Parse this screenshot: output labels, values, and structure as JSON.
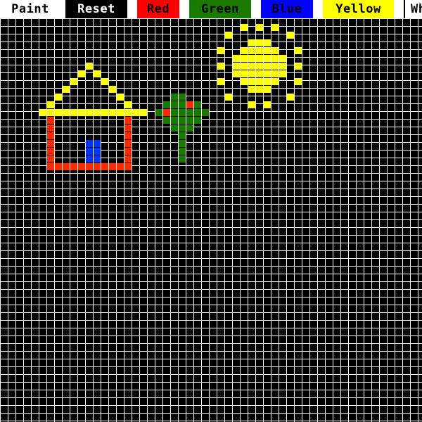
{
  "toolbar": {
    "title": "Paint",
    "reset_label": "Reset",
    "colors": [
      {
        "label": "Red",
        "bg": "#ff0000",
        "fg": "#000000"
      },
      {
        "label": "Green",
        "bg": "#1a7a00",
        "fg": "#000000"
      },
      {
        "label": "Blue",
        "bg": "#0000ff",
        "fg": "#000000"
      },
      {
        "label": "Yellow",
        "bg": "#ffff00",
        "fg": "#000000"
      },
      {
        "label": "White",
        "bg": "#ffffff",
        "fg": "#000000"
      }
    ]
  },
  "palette": {
    "red": "#ff2a00",
    "green": "#1a7a00",
    "blue": "#0033ff",
    "yellow": "#ffff00",
    "grid_line": "#ffffff",
    "background": "#000000"
  },
  "painted_cells": {
    "yellow": [
      [
        11,
        8
      ],
      [
        10,
        9
      ],
      [
        12,
        9
      ],
      [
        9,
        10
      ],
      [
        13,
        10
      ],
      [
        8,
        11
      ],
      [
        14,
        11
      ],
      [
        7,
        12
      ],
      [
        15,
        12
      ],
      [
        6,
        13
      ],
      [
        16,
        13
      ],
      [
        5,
        14
      ],
      [
        6,
        14
      ],
      [
        7,
        14
      ],
      [
        8,
        14
      ],
      [
        9,
        14
      ],
      [
        10,
        14
      ],
      [
        11,
        14
      ],
      [
        12,
        14
      ],
      [
        13,
        14
      ],
      [
        14,
        14
      ],
      [
        15,
        14
      ],
      [
        16,
        14
      ],
      [
        17,
        14
      ],
      [
        18,
        14
      ],
      [
        31,
        3
      ],
      [
        33,
        3
      ],
      [
        35,
        3
      ],
      [
        29,
        4
      ],
      [
        37,
        4
      ],
      [
        32,
        5
      ],
      [
        33,
        5
      ],
      [
        34,
        5
      ],
      [
        28,
        6
      ],
      [
        31,
        6
      ],
      [
        32,
        6
      ],
      [
        33,
        6
      ],
      [
        34,
        6
      ],
      [
        35,
        6
      ],
      [
        38,
        6
      ],
      [
        30,
        7
      ],
      [
        31,
        7
      ],
      [
        32,
        7
      ],
      [
        33,
        7
      ],
      [
        34,
        7
      ],
      [
        35,
        7
      ],
      [
        36,
        7
      ],
      [
        28,
        8
      ],
      [
        30,
        8
      ],
      [
        31,
        8
      ],
      [
        32,
        8
      ],
      [
        33,
        8
      ],
      [
        34,
        8
      ],
      [
        35,
        8
      ],
      [
        36,
        8
      ],
      [
        38,
        8
      ],
      [
        30,
        9
      ],
      [
        31,
        9
      ],
      [
        32,
        9
      ],
      [
        33,
        9
      ],
      [
        34,
        9
      ],
      [
        35,
        9
      ],
      [
        36,
        9
      ],
      [
        28,
        10
      ],
      [
        31,
        10
      ],
      [
        32,
        10
      ],
      [
        33,
        10
      ],
      [
        34,
        10
      ],
      [
        35,
        10
      ],
      [
        38,
        10
      ],
      [
        32,
        11
      ],
      [
        33,
        11
      ],
      [
        34,
        11
      ],
      [
        29,
        12
      ],
      [
        37,
        12
      ],
      [
        32,
        13
      ],
      [
        34,
        13
      ]
    ],
    "red": [
      [
        6,
        15
      ],
      [
        16,
        15
      ],
      [
        6,
        16
      ],
      [
        16,
        16
      ],
      [
        6,
        17
      ],
      [
        16,
        17
      ],
      [
        6,
        18
      ],
      [
        16,
        18
      ],
      [
        6,
        19
      ],
      [
        16,
        19
      ],
      [
        6,
        20
      ],
      [
        16,
        20
      ],
      [
        6,
        21
      ],
      [
        7,
        21
      ],
      [
        8,
        21
      ],
      [
        9,
        21
      ],
      [
        10,
        21
      ],
      [
        11,
        21
      ],
      [
        12,
        21
      ],
      [
        13,
        21
      ],
      [
        14,
        21
      ],
      [
        15,
        21
      ],
      [
        16,
        21
      ],
      [
        21,
        14
      ],
      [
        24,
        13
      ]
    ],
    "blue": [
      [
        11,
        18
      ],
      [
        12,
        18
      ],
      [
        11,
        19
      ],
      [
        12,
        19
      ],
      [
        11,
        20
      ],
      [
        12,
        20
      ]
    ],
    "green": [
      [
        22,
        12
      ],
      [
        23,
        12
      ],
      [
        21,
        13
      ],
      [
        22,
        13
      ],
      [
        23,
        13
      ],
      [
        25,
        13
      ],
      [
        20,
        14
      ],
      [
        22,
        14
      ],
      [
        23,
        14
      ],
      [
        24,
        14
      ],
      [
        25,
        14
      ],
      [
        26,
        14
      ],
      [
        21,
        15
      ],
      [
        22,
        15
      ],
      [
        23,
        15
      ],
      [
        24,
        15
      ],
      [
        25,
        15
      ],
      [
        22,
        16
      ],
      [
        23,
        16
      ],
      [
        24,
        16
      ],
      [
        23,
        17
      ],
      [
        23,
        18
      ],
      [
        23,
        19
      ],
      [
        23,
        20
      ]
    ]
  }
}
